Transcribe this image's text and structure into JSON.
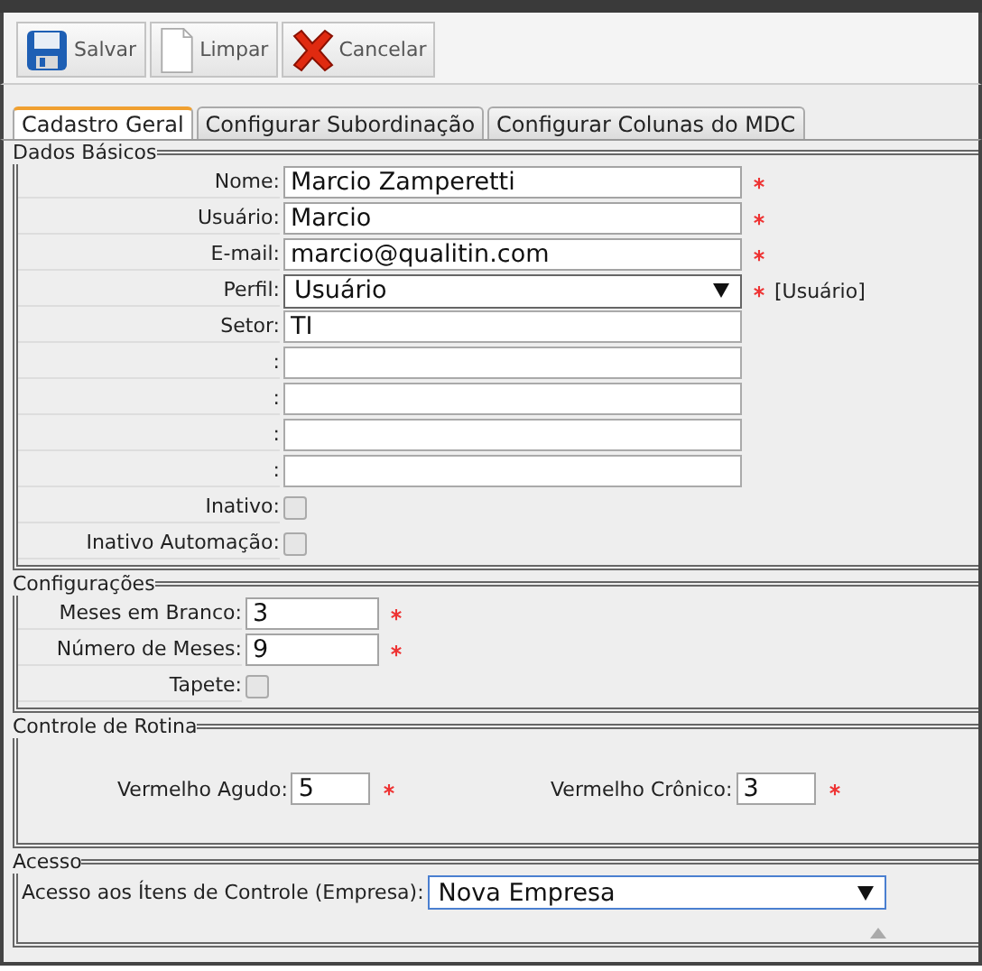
{
  "toolbar": {
    "buttons": [
      {
        "kind": "save",
        "label": "Salvar",
        "disabled": false
      },
      {
        "kind": "clear",
        "label": "Limpar",
        "disabled": false
      },
      {
        "kind": "cancel",
        "label": "Cancelar",
        "disabled": false
      }
    ]
  },
  "tabs": [
    {
      "label": "Cadastro Geral",
      "selected": true
    },
    {
      "label": "Configurar Subordinação",
      "selected": false
    },
    {
      "label": "Configurar Colunas do MDC",
      "selected": false
    }
  ],
  "sections": [
    {
      "title": "Dados Básicos",
      "kind": "rows",
      "fields": [
        {
          "kind": "text",
          "label": "Nome:",
          "value": "Marcio Zamperetti",
          "required": true
        },
        {
          "kind": "text",
          "label": "Usuário:",
          "value": "Marcio",
          "required": true
        },
        {
          "kind": "text",
          "label": "E-mail:",
          "value": "marcio@qualitin.com",
          "required": true
        },
        {
          "kind": "select",
          "label": "Perfil:",
          "value": "Usuário",
          "required": true,
          "note": "[Usuário]"
        },
        {
          "kind": "text",
          "label": "Setor:",
          "value": "TI"
        },
        {
          "kind": "text",
          "label": ":"
        },
        {
          "kind": "text",
          "label": ":"
        },
        {
          "kind": "text",
          "label": ":"
        },
        {
          "kind": "text",
          "label": ":"
        },
        {
          "kind": "checkbox",
          "label": "Inativo:",
          "checked": false
        },
        {
          "kind": "checkbox",
          "label": "Inativo Automação:",
          "checked": false
        }
      ]
    },
    {
      "title": "Configurações",
      "kind": "short",
      "fields": [
        {
          "kind": "text",
          "label": "Meses em Branco:",
          "value": "3",
          "required": true
        },
        {
          "kind": "text",
          "label": "Número de Meses:",
          "value": "9",
          "required": true
        },
        {
          "kind": "checkbox",
          "label": "Tapete:",
          "checked": false
        }
      ]
    },
    {
      "title": "Controle de Rotina",
      "kind": "inline",
      "fields": [
        {
          "kind": "text",
          "label": "Vermelho Agudo:",
          "value": "5",
          "required": true
        },
        {
          "kind": "text",
          "label": "Vermelho Crônico:",
          "value": "3",
          "required": true
        }
      ]
    },
    {
      "title": "Acesso",
      "kind": "wide",
      "fields": [
        {
          "kind": "select",
          "label": "Acesso aos Ítens de Controle (Empresa):",
          "value": "Nova Empresa",
          "focused": true
        }
      ]
    }
  ]
}
